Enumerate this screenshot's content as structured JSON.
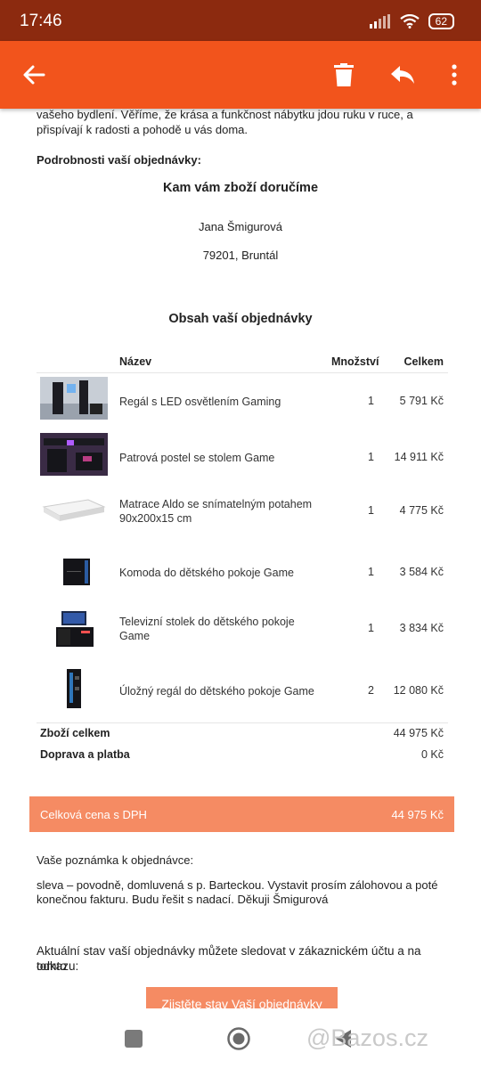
{
  "status": {
    "time": "17:46",
    "battery": "62"
  },
  "appbar": {
    "back_icon": "arrow-left-icon",
    "delete_icon": "trash-icon",
    "reply_icon": "reply-icon",
    "more_icon": "more-vert-icon"
  },
  "email": {
    "intro_line1": "vašeho bydlení. Věříme, že krása a funkčnost nábytku jdou ruku v ruce, a",
    "intro_line2": "přispívají k radosti a pohodě u vás doma.",
    "details_heading": "Podrobnosti vaší objednávky:",
    "delivery_heading": "Kam vám zboží doručíme",
    "delivery_name": "Jana Šmigurová",
    "delivery_city": "79201, Bruntál",
    "contents_heading": "Obsah vaší objednávky",
    "table": {
      "col_name": "Název",
      "col_qty": "Množství",
      "col_total": "Celkem",
      "items": [
        {
          "name": "Regál s LED osvětlením Gaming",
          "qty": "1",
          "total": "5 791 Kč"
        },
        {
          "name": "Patrová postel se stolem Game",
          "qty": "1",
          "total": "14 911 Kč"
        },
        {
          "name": "Matrace Aldo se snímatelným potahem 90x200x15 cm",
          "qty": "1",
          "total": "4 775 Kč"
        },
        {
          "name": "Komoda do dětského pokoje Game",
          "qty": "1",
          "total": "3 584 Kč"
        },
        {
          "name": "Televizní stolek do dětského pokoje Game",
          "qty": "1",
          "total": "3 834 Kč"
        },
        {
          "name": "Úložný regál do dětského pokoje Game",
          "qty": "2",
          "total": "12 080 Kč"
        }
      ]
    },
    "goods_total_label": "Zboží celkem",
    "goods_total_value": "44 975 Kč",
    "shipping_label": "Doprava a platba",
    "shipping_value": "0 Kč",
    "grand_total_label": "Celková cena s DPH",
    "grand_total_value": "44 975 Kč",
    "note_label": "Vaše poznámka k objednávce:",
    "note_line1": "sleva – povodně, domluvená s p. Barteckou. Vystavit prosím zálohovou a poté",
    "note_line2": "konečnou fakturu. Budu řešit s nadací. Děkuji Šmigurová",
    "status_line1": "Aktuální stav vaší objednávky můžete sledovat v zákaznickém účtu a na tomto",
    "status_line2": "odkazu:",
    "status_button": "Zjistěte stav Vaší objednávky"
  },
  "watermark": "@Bazos.cz",
  "colors": {
    "appbar": "#f2541c",
    "statusbar": "#8c2a0f",
    "accent": "#f58b63"
  }
}
